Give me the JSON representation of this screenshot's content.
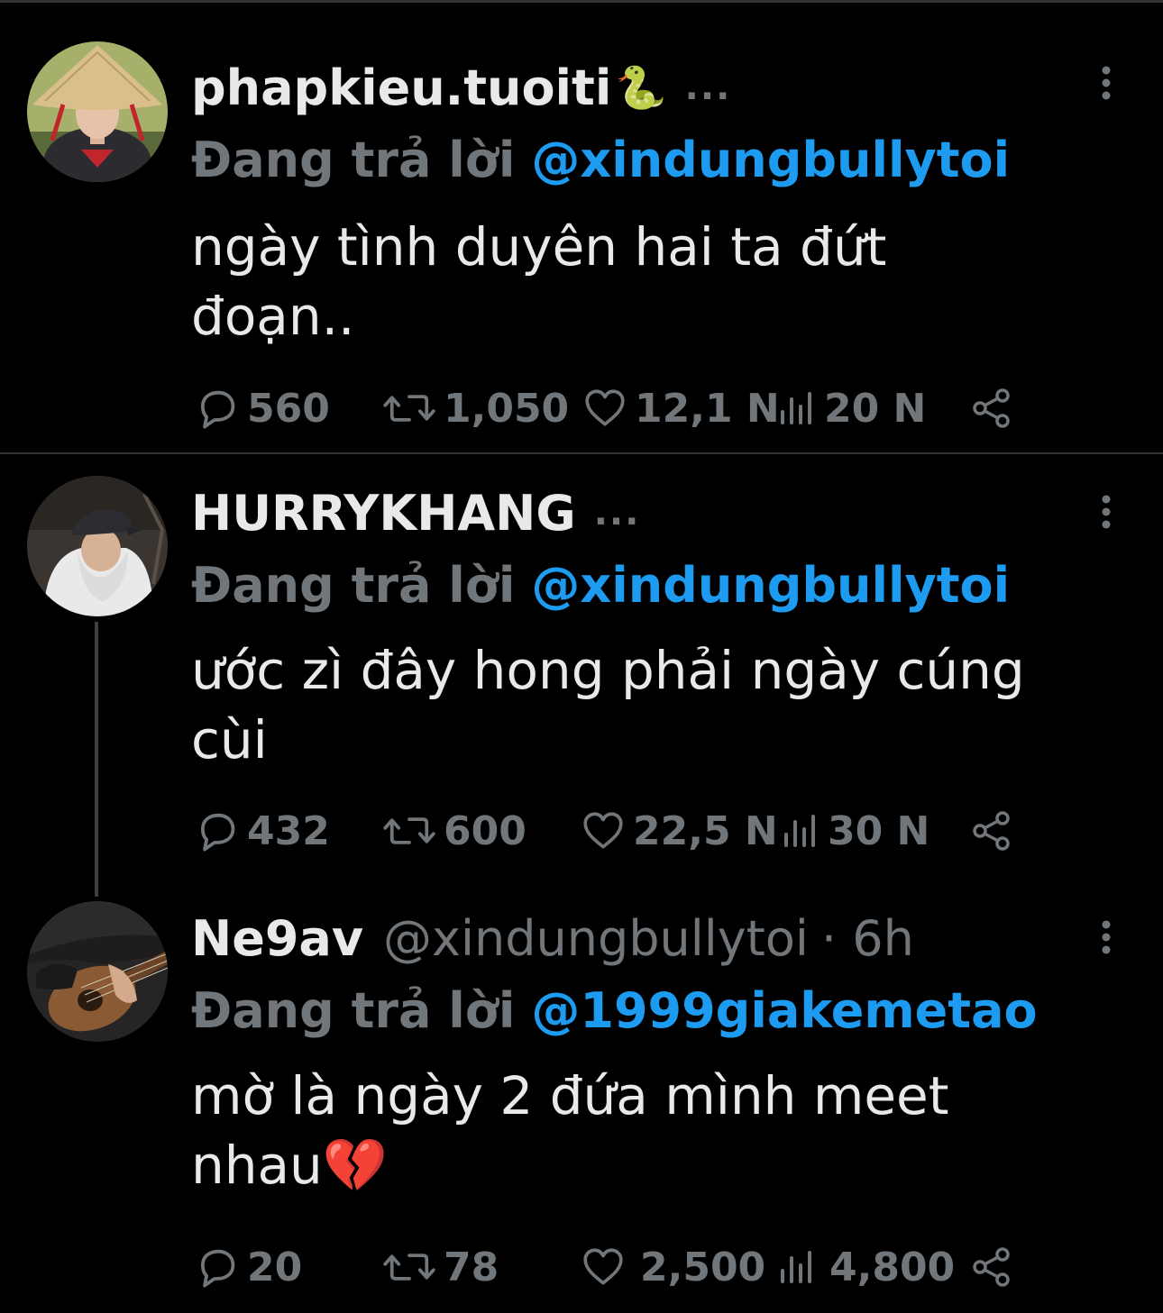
{
  "colors": {
    "background": "#000000",
    "text_primary": "#e7e9ea",
    "text_secondary": "#71767b",
    "link": "#1d9bf0",
    "divider": "#2f3336"
  },
  "tweets": [
    {
      "display_name": "phapkieu.tuoiti",
      "name_emoji": "🐍",
      "handle": "",
      "time": "",
      "truncation": "...",
      "reply_prefix": "Đang trả lời",
      "reply_mention": "@xindungbullytoi",
      "text_line1": "ngày tình duyên hai ta đứt",
      "text_line2": "đoạn..",
      "replies": "560",
      "retweets": "1,050",
      "likes": "12,1 N",
      "views": "20 N",
      "avatar_icon": "avatar-conical-hat-icon"
    },
    {
      "display_name": "HURRYKHANG",
      "name_emoji": "",
      "handle": "",
      "time": "",
      "truncation": "...",
      "reply_prefix": "Đang trả lời",
      "reply_mention": "@xindungbullytoi",
      "text_line1": "ước zì đây hong phải ngày cúng",
      "text_line2": "cùi",
      "replies": "432",
      "retweets": "600",
      "likes": "22,5 N",
      "views": "30 N",
      "avatar_icon": "avatar-cap-hoodie-icon"
    },
    {
      "display_name": "Ne9av",
      "name_emoji": "",
      "handle": "@xindungbullytoi",
      "time": "· 6h",
      "truncation": "",
      "reply_prefix": "Đang trả lời",
      "reply_mention": "@1999giakemetao",
      "text_line1": "mờ là ngày 2 đứa mình meet",
      "text_line2": "nhau💔",
      "replies": "20",
      "retweets": "78",
      "likes": "2,500",
      "views": "4,800",
      "avatar_icon": "avatar-guitar-icon"
    }
  ]
}
